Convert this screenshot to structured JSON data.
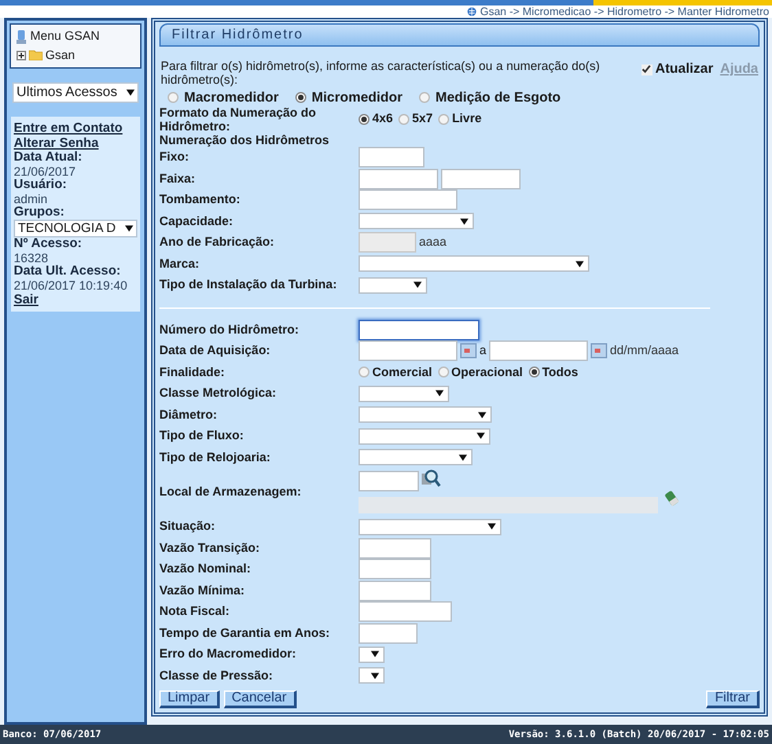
{
  "breadcrumb": "Gsan -> Micromedicao -> Hidrometro -> Manter Hidrometro",
  "sidebar": {
    "menu_title": "Menu GSAN",
    "tree": [
      {
        "label": "Gsan",
        "expanded": false
      }
    ],
    "recent_dropdown": "Ultimos Acessos",
    "links": [
      "Entre em Contato",
      "Alterar Senha"
    ],
    "info": [
      {
        "kind": "text",
        "label": "Data Atual:",
        "value": "21/06/2017"
      },
      {
        "kind": "text",
        "label": "Usuário:",
        "value": "admin"
      },
      {
        "kind": "select",
        "label": "Grupos:",
        "value": "TECNOLOGIA D"
      },
      {
        "kind": "text",
        "label": "Nº Acesso:",
        "value": "16328"
      },
      {
        "kind": "text",
        "label": "Data Ult. Acesso:",
        "value": "21/06/2017 10:19:40"
      }
    ],
    "logout": "Sair"
  },
  "panel": {
    "title": "Filtrar Hidrômetro",
    "intro": "Para filtrar o(s) hidrômetro(s), informe as característica(s) ou a numeração do(s) hidrômetro(s):",
    "update": {
      "label": "Atualizar",
      "checked": true
    },
    "help": "Ajuda",
    "types": [
      {
        "label": "Macromedidor",
        "selected": false
      },
      {
        "label": "Micromedidor",
        "selected": true
      },
      {
        "label": "Medição de Esgoto",
        "selected": false
      }
    ],
    "format": {
      "label": "Formato da Numeração do Hidrômetro:",
      "options": [
        {
          "label": "4x6",
          "selected": true
        },
        {
          "label": "5x7",
          "selected": false
        },
        {
          "label": "Livre",
          "selected": false
        }
      ]
    },
    "section_label": "Numeração dos Hidrômetros",
    "fields_1": [
      {
        "kind": "text",
        "label": "Fixo:"
      },
      {
        "kind": "range",
        "label": "Faixa:"
      },
      {
        "kind": "text",
        "label": "Tombamento:"
      },
      {
        "kind": "select",
        "label": "Capacidade:"
      },
      {
        "kind": "year",
        "label": "Ano de Fabricação:",
        "hint": "aaaa"
      },
      {
        "kind": "select",
        "label": "Marca:"
      },
      {
        "kind": "select",
        "label": "Tipo de Instalação da Turbina:"
      }
    ],
    "fields_2": [
      {
        "kind": "text",
        "label": "Número do Hidrômetro:",
        "focused": true
      },
      {
        "kind": "dates",
        "label": "Data de Aquisição:",
        "between": "a",
        "hint": "dd/mm/aaaa"
      },
      {
        "kind": "radios",
        "label": "Finalidade:",
        "options": [
          {
            "label": "Comercial",
            "selected": false
          },
          {
            "label": "Operacional",
            "selected": false
          },
          {
            "label": "Todos",
            "selected": true
          }
        ]
      },
      {
        "kind": "select",
        "label": "Classe Metrológica:"
      },
      {
        "kind": "select",
        "label": "Diâmetro:"
      },
      {
        "kind": "select",
        "label": "Tipo de Fluxo:"
      },
      {
        "kind": "select",
        "label": "Tipo de Relojoaria:"
      },
      {
        "kind": "lookup",
        "label": "Local de Armazenagem:"
      },
      {
        "kind": "select",
        "label": "Situação:"
      },
      {
        "kind": "text",
        "label": "Vazão Transição:"
      },
      {
        "kind": "text",
        "label": "Vazão Nominal:"
      },
      {
        "kind": "text",
        "label": "Vazão Mínima:"
      },
      {
        "kind": "text",
        "label": "Nota Fiscal:"
      },
      {
        "kind": "text",
        "label": "Tempo de Garantia em Anos:"
      },
      {
        "kind": "select",
        "label": "Erro do Macromedidor:"
      },
      {
        "kind": "select",
        "label": "Classe de Pressão:"
      }
    ],
    "buttons": [
      {
        "label": "Limpar",
        "kind": "left"
      },
      {
        "label": "Cancelar",
        "kind": "left"
      },
      {
        "label": "Filtrar",
        "kind": "right"
      }
    ]
  },
  "footer": {
    "left": "Banco: 07/06/2017",
    "right": "Versão: 3.6.1.0 (Batch) 20/06/2017 - 17:02:05"
  }
}
